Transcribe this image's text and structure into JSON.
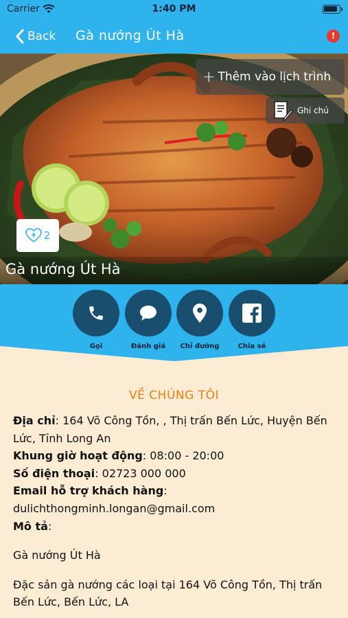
{
  "status_bar": {
    "carrier": "Carrier",
    "time": "1:40 PM"
  },
  "nav": {
    "back_label": "Back",
    "title": "Gà nướng Út Hà",
    "alert_icon": "alert-icon"
  },
  "hero": {
    "add_trip_label": "Thêm vào lịch trình",
    "note_label": "Ghi chú",
    "like_count": "2",
    "caption": "Gà nướng Út Hà"
  },
  "actions": [
    {
      "label": "Gọi",
      "icon": "phone-icon"
    },
    {
      "label": "Đánh giá",
      "icon": "chat-bubble-icon"
    },
    {
      "label": "Chỉ đường",
      "icon": "map-pin-icon"
    },
    {
      "label": "Chia sẻ",
      "icon": "facebook-icon"
    }
  ],
  "about": {
    "title": "VỀ CHÚNG TÔI",
    "address_label": "Địa chỉ",
    "address_value": "164 Võ Công Tồn, , Thị trấn Bến Lức, Huyện Bến Lức, Tỉnh Long An",
    "hours_label": "Khung giờ hoạt động",
    "hours_value": "08:00 - 20:00",
    "phone_label": "Số điện thoại",
    "phone_value": "02723 000 000",
    "email_label": "Email hỗ trợ khách hàng",
    "email_value": "dulichthongminh.longan@gmail.com",
    "desc_label": "Mô tả",
    "desc_title": "Gà nướng Út Hà",
    "desc_body": "Đặc sản gà nướng các loại tại 164 Võ Công Tồn, Thị trấn Bến Lức,  Bến Lức, LA"
  },
  "colors": {
    "primary": "#2eb3ec",
    "dark_circle": "#1a4e6e",
    "accent": "#f07f10",
    "content_bg": "#fdecd4",
    "alert": "#e8372c"
  }
}
